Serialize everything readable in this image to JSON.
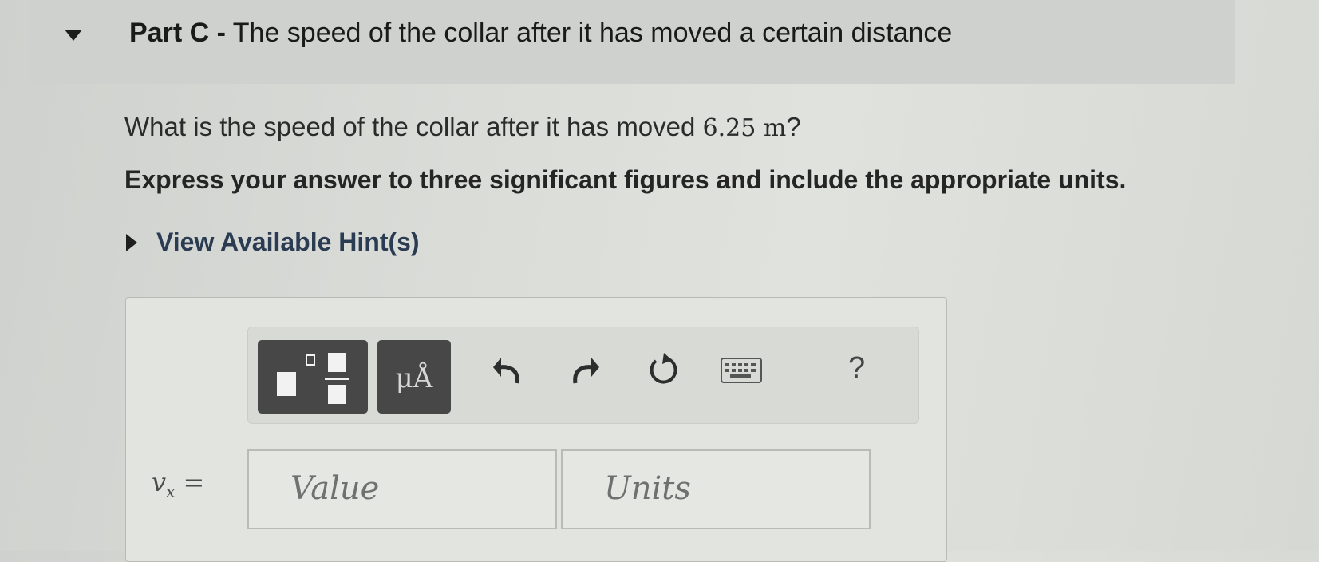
{
  "part": {
    "label": "Part C -",
    "title": "The speed of the collar after it has moved a certain distance"
  },
  "question": {
    "prefix": "What is the speed of the collar after it has moved",
    "quantity": "6.25 m",
    "suffix": "?"
  },
  "instruction": "Express your answer to three significant figures and include the appropriate units.",
  "hints": {
    "label": "View Available Hint(s)"
  },
  "toolbar": {
    "templates_icon": "templates-icon",
    "units_label": "μÅ",
    "undo_icon": "undo-icon",
    "redo_icon": "redo-icon",
    "reset_icon": "reset-icon",
    "keyboard_icon": "keyboard-icon",
    "help_label": "?"
  },
  "answer": {
    "variable": "v",
    "subscript": "x",
    "equals": "=",
    "value_placeholder": "Value",
    "units_placeholder": "Units"
  }
}
